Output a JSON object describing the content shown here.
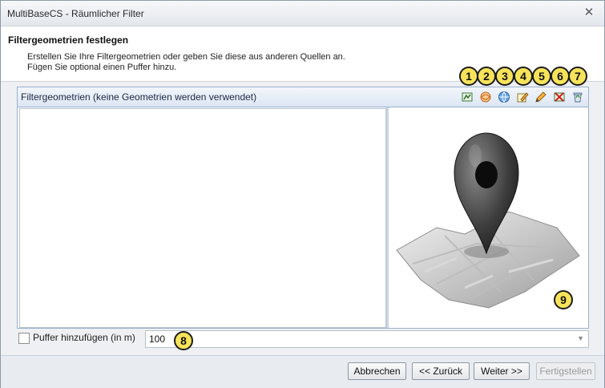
{
  "window": {
    "title": "MultiBaseCS - Räumlicher Filter",
    "close_glyph": "✕"
  },
  "header": {
    "title": "Filtergeometrien festlegen",
    "description_line1": "Erstellen Sie Ihre Filtergeometrien oder geben Sie diese aus anderen Quellen an.",
    "description_line2": "Fügen Sie optional einen Puffer hinzu."
  },
  "panel": {
    "title": "Filtergeometrien (keine Geometrien werden verwendet)",
    "toolbar_icons": [
      "map-select-icon",
      "shape-draw-icon",
      "globe-icon",
      "edit-geometry-icon",
      "pencil-icon",
      "remove-geometry-icon",
      "recycle-bin-icon"
    ]
  },
  "callouts": [
    "1",
    "2",
    "3",
    "4",
    "5",
    "6",
    "7",
    "8",
    "9"
  ],
  "buffer": {
    "checkbox_label": "Puffer hinzufügen (in m)",
    "checked": false,
    "value": "100"
  },
  "footer": {
    "cancel_label": "Abbrechen",
    "back_label": "<< Zurück",
    "next_label": "Weiter >>",
    "finish_label": "Fertigstellen",
    "finish_enabled": false
  },
  "colors": {
    "callout_fill": "#f7e35a",
    "panel_border": "#9bb1cc"
  }
}
